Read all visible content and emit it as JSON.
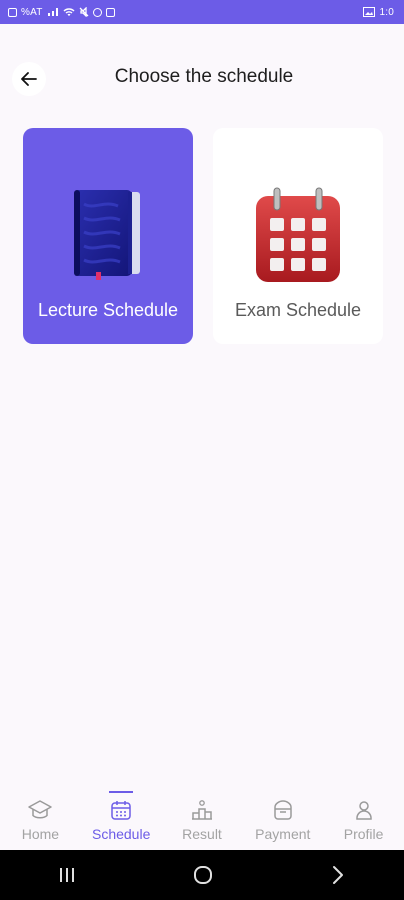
{
  "status_bar": {
    "left_text": "%AT",
    "time": "1:0"
  },
  "header": {
    "title": "Choose the schedule",
    "back_icon": "arrow-left-icon"
  },
  "cards": [
    {
      "label": "Lecture Schedule",
      "icon": "notebook-icon",
      "selected": true
    },
    {
      "label": "Exam Schedule",
      "icon": "calendar-icon",
      "selected": false
    }
  ],
  "bottom_nav": {
    "items": [
      {
        "label": "Home",
        "icon": "graduation-cap-icon"
      },
      {
        "label": "Schedule",
        "icon": "calendar-icon"
      },
      {
        "label": "Result",
        "icon": "podium-icon"
      },
      {
        "label": "Payment",
        "icon": "wallet-icon"
      },
      {
        "label": "Profile",
        "icon": "user-icon"
      }
    ],
    "active": "Schedule"
  },
  "colors": {
    "accent": "#6c5ce7",
    "background": "#fbf8fc",
    "inactive": "#a3a3a3"
  }
}
